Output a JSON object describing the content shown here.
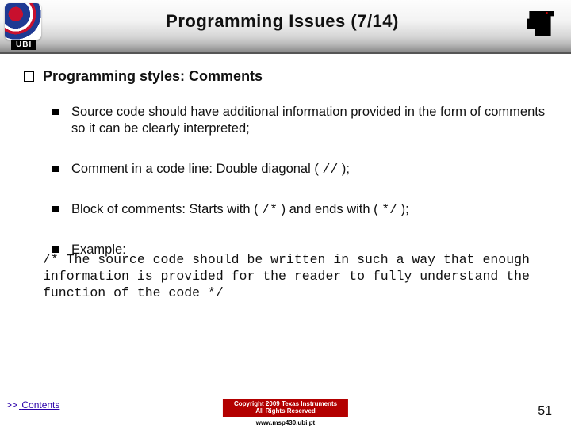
{
  "header": {
    "title": "Programming Issues (7/14)",
    "ubi": "UBI"
  },
  "content": {
    "h1": "Programming styles: Comments",
    "items": [
      "Source code should have additional information provided in the form of comments so it can be clearly interpreted;",
      "Comment in a code line: Double diagonal ( // );",
      "Block of comments: Starts with ( /* ) and ends with ( */ );",
      "Example:"
    ],
    "example": "/* The source code should be written in such a way that enough information is provided for the reader to fully understand the function of the code */"
  },
  "footer": {
    "contents": ">> Contents",
    "copyright": "Copyright 2009 Texas Instruments\nAll Rights Reserved",
    "url": "www.msp430.ubi.pt",
    "page": "51"
  }
}
